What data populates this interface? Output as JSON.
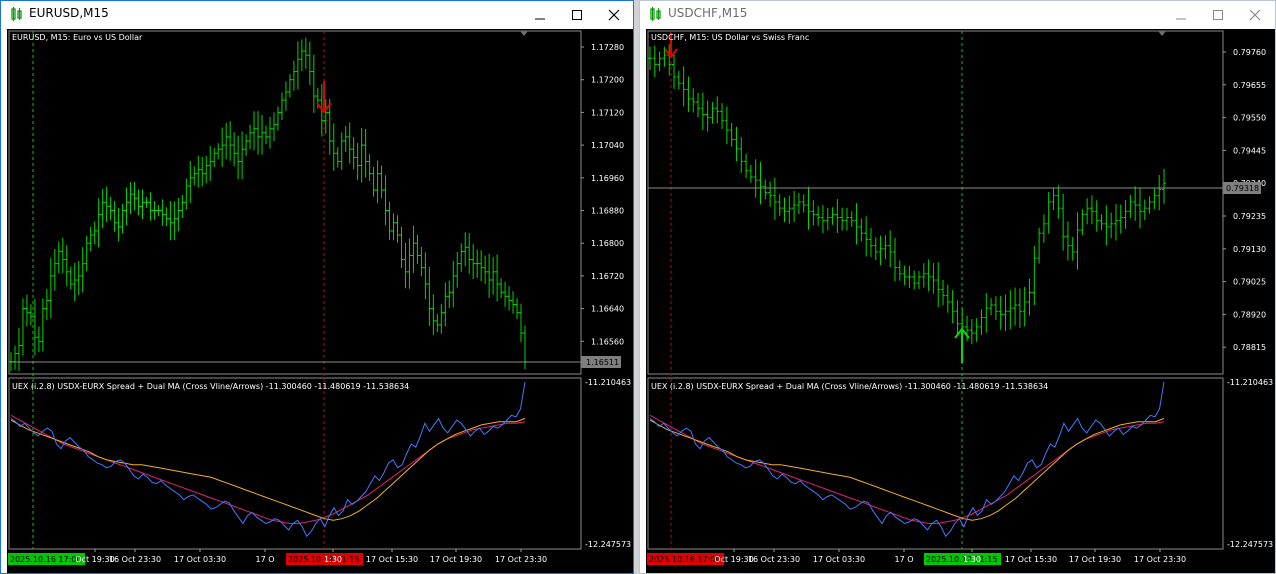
{
  "left": {
    "title": "EURUSD,M15",
    "main_label": "EURUSD, M15:  Euro vs US Dollar",
    "price_ticks": [
      "1.17280",
      "1.17200",
      "1.17120",
      "1.17040",
      "1.16960",
      "1.16880",
      "1.16800",
      "1.16720",
      "1.16640",
      "1.16560"
    ],
    "current_price": "1.16511",
    "ind_label": "UEX (i.2.8) USDX-EURX Spread + Dual MA (Cross Vline/Arrows) -11.300460 -11.480619 -11.538634",
    "ind_top": "-11.210463",
    "ind_bot": "-12.247573",
    "time_ticks": [
      "Oct 19:30",
      "16 Oct 23:30",
      "17 Oct 03:30",
      "17 O",
      "1:30",
      "17 Oct 15:30",
      "17 Oct 19:30",
      "17 Oct 23:30"
    ],
    "hl_green": "2025.10.16 17:00",
    "hl_red": "2025.10.17 11:15",
    "close_series": [
      1.1651,
      1.1653,
      1.1655,
      1.1664,
      1.1663,
      1.1662,
      1.1657,
      1.1656,
      1.1664,
      1.1666,
      1.1672,
      1.1675,
      1.1678,
      1.1676,
      1.1673,
      1.167,
      1.1671,
      1.1672,
      1.1675,
      1.168,
      1.1682,
      1.1683,
      1.1687,
      1.169,
      1.1689,
      1.1688,
      1.1685,
      1.1684,
      1.1688,
      1.169,
      1.1692,
      1.1691,
      1.1689,
      1.169,
      1.169,
      1.1688,
      1.1688,
      1.1688,
      1.1687,
      1.1686,
      1.1685,
      1.1686,
      1.1688,
      1.169,
      1.1694,
      1.1696,
      1.1697,
      1.1698,
      1.1697,
      1.1699,
      1.17,
      1.1702,
      1.1703,
      1.1704,
      1.1706,
      1.1704,
      1.1702,
      1.17,
      1.1703,
      1.1705,
      1.1707,
      1.1708,
      1.1706,
      1.1707,
      1.1706,
      1.1708,
      1.1709,
      1.1712,
      1.1715,
      1.1717,
      1.172,
      1.1722,
      1.1725,
      1.1727,
      1.1726,
      1.1722,
      1.1716,
      1.1715,
      1.171,
      1.1712,
      1.1705,
      1.1702,
      1.17,
      1.1705,
      1.1706,
      1.1703,
      1.1701,
      1.1699,
      1.1704,
      1.17,
      1.1697,
      1.1693,
      1.1697,
      1.1693,
      1.1688,
      1.1683,
      1.1685,
      1.1682,
      1.1676,
      1.1673,
      1.1677,
      1.168,
      1.1677,
      1.1674,
      1.167,
      1.1664,
      1.1661,
      1.166,
      1.1663,
      1.1667,
      1.1668,
      1.1672,
      1.1675,
      1.1678,
      1.1679,
      1.1676,
      1.1675,
      1.1675,
      1.1674,
      1.1673,
      1.1671,
      1.1673,
      1.167,
      1.1668,
      1.1667,
      1.1666,
      1.1665,
      1.1663,
      1.1658,
      1.1651
    ]
  },
  "right": {
    "title": "USDCHF,M15",
    "main_label": "USDCHF, M15:  US Dollar vs Swiss Franc",
    "price_ticks": [
      "0.79760",
      "0.79655",
      "0.79550",
      "0.79445",
      "0.79340",
      "0.79235",
      "0.79130",
      "0.79025",
      "0.78920",
      "0.78815"
    ],
    "current_price": "0.79318",
    "ind_label": "UEX (i.2.8) USDX-EURX Spread + Dual MA (Cross Vline/Arrows) -11.300460 -11.480619 -11.538634",
    "ind_top": "-11.210463",
    "ind_bot": "-12.247573",
    "time_ticks": [
      "Oct 19:30",
      "16 Oct 23:30",
      "17 Oct 03:30",
      "17 O",
      "1:30",
      "17 Oct 15:30",
      "17 Oct 19:30",
      "17 Oct 23:30"
    ],
    "hl_red": "2025.10.16 17:00",
    "hl_green": "2025.10.17 11:15",
    "close_series": [
      0.7974,
      0.7972,
      0.7974,
      0.7975,
      0.7972,
      0.7968,
      0.7966,
      0.7964,
      0.7961,
      0.796,
      0.7958,
      0.7956,
      0.7955,
      0.7958,
      0.7957,
      0.7954,
      0.7951,
      0.7948,
      0.7945,
      0.7941,
      0.7938,
      0.7936,
      0.7935,
      0.7933,
      0.7931,
      0.793,
      0.7928,
      0.7926,
      0.7925,
      0.7926,
      0.7927,
      0.7928,
      0.7927,
      0.7925,
      0.7924,
      0.7923,
      0.7922,
      0.7923,
      0.7924,
      0.7923,
      0.7922,
      0.7923,
      0.7922,
      0.792,
      0.7918,
      0.7916,
      0.7914,
      0.7912,
      0.7913,
      0.7914,
      0.7912,
      0.7907,
      0.7905,
      0.7904,
      0.7904,
      0.7902,
      0.7904,
      0.7905,
      0.7904,
      0.7903,
      0.79,
      0.7898,
      0.7896,
      0.7893,
      0.7889,
      0.7888,
      0.7887,
      0.7886,
      0.7888,
      0.7891,
      0.7894,
      0.7895,
      0.7893,
      0.7892,
      0.7893,
      0.7894,
      0.7895,
      0.7893,
      0.7896,
      0.7899,
      0.791,
      0.7918,
      0.7921,
      0.7928,
      0.793,
      0.7926,
      0.7917,
      0.7914,
      0.7912,
      0.7919,
      0.7924,
      0.7926,
      0.7925,
      0.7922,
      0.7921,
      0.792,
      0.7921,
      0.7922,
      0.7923,
      0.7925,
      0.7928,
      0.7927,
      0.7925,
      0.7926,
      0.7928,
      0.793,
      0.7932,
      0.7934
    ]
  },
  "indicator": {
    "blue": [
      -11.44,
      -11.46,
      -11.49,
      -11.47,
      -11.5,
      -11.53,
      -11.55,
      -11.52,
      -11.5,
      -11.52,
      -11.6,
      -11.63,
      -11.58,
      -11.56,
      -11.59,
      -11.62,
      -11.64,
      -11.68,
      -11.7,
      -11.72,
      -11.73,
      -11.75,
      -11.74,
      -11.71,
      -11.7,
      -11.72,
      -11.76,
      -11.8,
      -11.82,
      -11.79,
      -11.81,
      -11.84,
      -11.85,
      -11.83,
      -11.86,
      -11.88,
      -11.9,
      -11.92,
      -11.95,
      -11.93,
      -11.92,
      -11.94,
      -11.96,
      -11.98,
      -12.01,
      -12.0,
      -11.98,
      -11.96,
      -11.97,
      -12.02,
      -12.06,
      -12.1,
      -12.05,
      -12.03,
      -12.06,
      -12.08,
      -12.1,
      -12.09,
      -12.07,
      -12.08,
      -12.11,
      -12.14,
      -12.1,
      -12.08,
      -12.12,
      -12.18,
      -12.15,
      -12.1,
      -12.07,
      -12.12,
      -12.05,
      -12.0,
      -12.05,
      -12.02,
      -11.95,
      -11.98,
      -11.96,
      -11.93,
      -11.9,
      -11.85,
      -11.8,
      -11.83,
      -11.78,
      -11.72,
      -11.7,
      -11.75,
      -11.73,
      -11.66,
      -11.6,
      -11.62,
      -11.55,
      -11.47,
      -11.52,
      -11.48,
      -11.44,
      -11.5,
      -11.53,
      -11.49,
      -11.45,
      -11.47,
      -11.51,
      -11.55,
      -11.52,
      -11.5,
      -11.54,
      -11.52,
      -11.49,
      -11.5,
      -11.48,
      -11.45,
      -11.42,
      -11.43,
      -11.38,
      -11.21
    ],
    "orange": [
      -11.45,
      -11.48,
      -11.51,
      -11.53,
      -11.55,
      -11.57,
      -11.59,
      -11.61,
      -11.63,
      -11.65,
      -11.68,
      -11.7,
      -11.71,
      -11.72,
      -11.73,
      -11.73,
      -11.74,
      -11.75,
      -11.76,
      -11.77,
      -11.78,
      -11.79,
      -11.8,
      -11.81,
      -11.83,
      -11.85,
      -11.87,
      -11.89,
      -11.91,
      -11.93,
      -11.95,
      -11.97,
      -11.99,
      -12.01,
      -12.03,
      -12.05,
      -12.07,
      -12.08,
      -12.07,
      -12.05,
      -12.02,
      -11.98,
      -11.94,
      -11.89,
      -11.84,
      -11.79,
      -11.74,
      -11.69,
      -11.64,
      -11.6,
      -11.57,
      -11.54,
      -11.52,
      -11.5,
      -11.48,
      -11.47,
      -11.46,
      -11.46,
      -11.46,
      -11.44
    ],
    "magenta": [
      -11.42,
      -11.45,
      -11.48,
      -11.51,
      -11.54,
      -11.57,
      -11.6,
      -11.62,
      -11.64,
      -11.66,
      -11.68,
      -11.7,
      -11.72,
      -11.74,
      -11.76,
      -11.78,
      -11.8,
      -11.82,
      -11.84,
      -11.86,
      -11.88,
      -11.9,
      -11.92,
      -11.94,
      -11.96,
      -11.98,
      -12.0,
      -12.02,
      -12.04,
      -12.06,
      -12.08,
      -12.09,
      -12.1,
      -12.1,
      -12.09,
      -12.08,
      -12.06,
      -12.04,
      -12.01,
      -11.98,
      -11.95,
      -11.92,
      -11.88,
      -11.84,
      -11.8,
      -11.76,
      -11.72,
      -11.68,
      -11.64,
      -11.6,
      -11.57,
      -11.55,
      -11.53,
      -11.51,
      -11.5,
      -11.49,
      -11.48,
      -11.47,
      -11.47,
      -11.46
    ]
  },
  "colors": {
    "candle": "#00d800",
    "grid_v_green": "#00c800",
    "grid_v_red": "#d80000",
    "price_line": "#8c8c8c",
    "blue": "#3d7dff",
    "orange": "#f0b020",
    "magenta": "#e0207a"
  },
  "icons": [
    "chart-app-icon",
    "minimize-icon",
    "maximize-icon",
    "close-icon",
    "down-arrow-icon",
    "up-arrow-icon"
  ]
}
